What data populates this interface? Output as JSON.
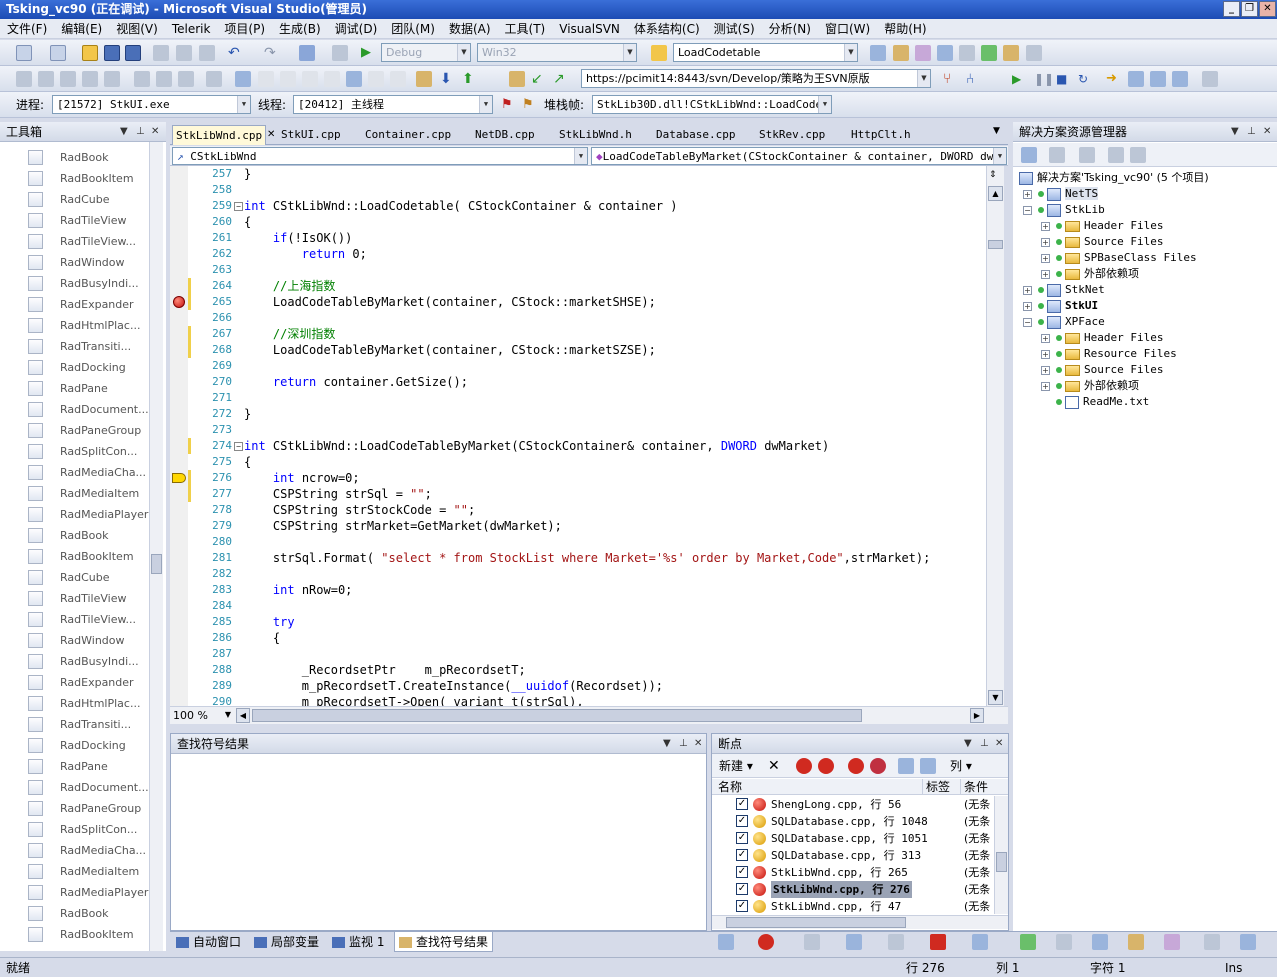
{
  "window": {
    "title": "Tsking_vc90 (正在调试) - Microsoft Visual Studio(管理员)",
    "controls": [
      "_",
      "❐",
      "✕"
    ]
  },
  "menu": [
    "文件(F)",
    "编辑(E)",
    "视图(V)",
    "Telerik",
    "项目(P)",
    "生成(B)",
    "调试(D)",
    "团队(M)",
    "数据(A)",
    "工具(T)",
    "VisualSVN",
    "体系结构(C)",
    "测试(S)",
    "分析(N)",
    "窗口(W)",
    "帮助(H)"
  ],
  "toolbar1": {
    "config": "Debug",
    "platform": "Win32",
    "find": "LoadCodetable"
  },
  "toolbar2": {
    "svn_url": "https://pcimit14:8443/svn/Develop/策略为王SVN原版"
  },
  "toolbar3": {
    "process_label": "进程:",
    "process": "[21572] StkUI.exe",
    "thread_label": "线程:",
    "thread": "[20412] 主线程",
    "stack_label": "堆栈帧:",
    "stack": "StkLib30D.dll!CStkLibWnd::LoadCodeTab"
  },
  "toolbox": {
    "title": "工具箱",
    "items": [
      "RadBook",
      "RadBookItem",
      "RadCube",
      "RadTileView",
      "RadTileView...",
      "RadWindow",
      "RadBusyIndi...",
      "RadExpander",
      "RadHtmlPlac...",
      "RadTransiti...",
      "RadDocking",
      "RadPane",
      "RadDocument...",
      "RadPaneGroup",
      "RadSplitCon...",
      "RadMediaCha...",
      "RadMediaItem",
      "RadMediaPlayer",
      "RadBook",
      "RadBookItem",
      "RadCube",
      "RadTileView",
      "RadTileView...",
      "RadWindow",
      "RadBusyIndi...",
      "RadExpander",
      "RadHtmlPlac...",
      "RadTransiti...",
      "RadDocking",
      "RadPane",
      "RadDocument...",
      "RadPaneGroup",
      "RadSplitCon...",
      "RadMediaCha...",
      "RadMediaItem",
      "RadMediaPlayer",
      "RadBook",
      "RadBookItem"
    ]
  },
  "tabs": [
    "StkLibWnd.cpp",
    "StkUI.cpp",
    "Container.cpp",
    "NetDB.cpp",
    "StkLibWnd.h",
    "Database.cpp",
    "StkRev.cpp",
    "HttpClt.h"
  ],
  "editor": {
    "class_combo": "CStkLibWnd",
    "method_combo": "LoadCodeTableByMarket(CStockContainer & container, DWORD dwMarke",
    "zoom": "100 %"
  },
  "code": [
    {
      "n": "257",
      "t": "}",
      "k": "p"
    },
    {
      "n": "258",
      "t": "",
      "k": "p"
    },
    {
      "n": "259",
      "t": "int CStkLibWnd::LoadCodetable( CStockContainer & container )",
      "k": "fn"
    },
    {
      "n": "260",
      "t": "{",
      "k": "p"
    },
    {
      "n": "261",
      "t": "    if(!IsOK())",
      "k": "if"
    },
    {
      "n": "262",
      "t": "        return 0;",
      "k": "ret"
    },
    {
      "n": "263",
      "t": "",
      "k": "p"
    },
    {
      "n": "264",
      "t": "    //上海指数",
      "k": "cm"
    },
    {
      "n": "265",
      "t": "    LoadCodeTableByMarket(container, CStock::marketSHSE);",
      "k": "p"
    },
    {
      "n": "266",
      "t": "",
      "k": "p"
    },
    {
      "n": "267",
      "t": "    //深圳指数",
      "k": "cm"
    },
    {
      "n": "268",
      "t": "    LoadCodeTableByMarket(container, CStock::marketSZSE);",
      "k": "p"
    },
    {
      "n": "269",
      "t": "",
      "k": "p"
    },
    {
      "n": "270",
      "t": "    return container.GetSize();",
      "k": "ret"
    },
    {
      "n": "271",
      "t": "",
      "k": "p"
    },
    {
      "n": "272",
      "t": "}",
      "k": "p"
    },
    {
      "n": "273",
      "t": "",
      "k": "p"
    },
    {
      "n": "274",
      "t": "int CStkLibWnd::LoadCodeTableByMarket(CStockContainer& container, DWORD dwMarket)",
      "k": "fn"
    },
    {
      "n": "275",
      "t": "{",
      "k": "p"
    },
    {
      "n": "276",
      "t": "    int ncrow=0;",
      "k": "int"
    },
    {
      "n": "277",
      "t": "    CSPString strSql = \"\";",
      "k": "p"
    },
    {
      "n": "278",
      "t": "    CSPString strStockCode = \"\";",
      "k": "p"
    },
    {
      "n": "279",
      "t": "    CSPString strMarket=GetMarket(dwMarket);",
      "k": "p"
    },
    {
      "n": "280",
      "t": "",
      "k": "p"
    },
    {
      "n": "281",
      "t": "    strSql.Format( \"select * from StockList where Market='%s' order by Market,Code\",strMarket);",
      "k": "p"
    },
    {
      "n": "282",
      "t": "",
      "k": "p"
    },
    {
      "n": "283",
      "t": "    int nRow=0;",
      "k": "int"
    },
    {
      "n": "284",
      "t": "",
      "k": "p"
    },
    {
      "n": "285",
      "t": "    try",
      "k": "try"
    },
    {
      "n": "286",
      "t": "    {",
      "k": "p"
    },
    {
      "n": "287",
      "t": "",
      "k": "p"
    },
    {
      "n": "288",
      "t": "        _RecordsetPtr    m_pRecordsetT;",
      "k": "p"
    },
    {
      "n": "289",
      "t": "        m_pRecordsetT.CreateInstance(__uuidof(Recordset));",
      "k": "p"
    },
    {
      "n": "290",
      "t": "        m_pRecordsetT->Open( variant_t(strSql),",
      "k": "p"
    }
  ],
  "solution": {
    "title": "解决方案资源管理器",
    "root": "解决方案'Tsking_vc90' (5 个项目)",
    "nodes": [
      {
        "label": "NetTS",
        "type": "prj",
        "lvl": 1,
        "exp": "+",
        "bold": false
      },
      {
        "label": "StkLib",
        "type": "prj",
        "lvl": 1,
        "exp": "-",
        "bold": false
      },
      {
        "label": "Header Files",
        "type": "fld",
        "lvl": 2,
        "exp": "+",
        "bold": false
      },
      {
        "label": "Source Files",
        "type": "fld",
        "lvl": 2,
        "exp": "+",
        "bold": false
      },
      {
        "label": "SPBaseClass Files",
        "type": "fld",
        "lvl": 2,
        "exp": "+",
        "bold": false
      },
      {
        "label": "外部依赖项",
        "type": "fld",
        "lvl": 2,
        "exp": "+",
        "bold": false
      },
      {
        "label": "StkNet",
        "type": "prj",
        "lvl": 1,
        "exp": "+",
        "bold": false
      },
      {
        "label": "StkUI",
        "type": "prj",
        "lvl": 1,
        "exp": "+",
        "bold": true
      },
      {
        "label": "XPFace",
        "type": "prj",
        "lvl": 1,
        "exp": "-",
        "bold": false
      },
      {
        "label": "Header Files",
        "type": "fld",
        "lvl": 2,
        "exp": "+",
        "bold": false
      },
      {
        "label": "Resource Files",
        "type": "fld",
        "lvl": 2,
        "exp": "+",
        "bold": false
      },
      {
        "label": "Source Files",
        "type": "fld",
        "lvl": 2,
        "exp": "+",
        "bold": false
      },
      {
        "label": "外部依赖项",
        "type": "fld",
        "lvl": 2,
        "exp": "+",
        "bold": false
      },
      {
        "label": "ReadMe.txt",
        "type": "file",
        "lvl": 2,
        "exp": "",
        "bold": false
      }
    ]
  },
  "find_symbol": {
    "title": "查找符号结果"
  },
  "breakpoints": {
    "title": "断点",
    "new_label": "新建",
    "columns_label": "列",
    "headers": [
      "名称",
      "标签",
      "条件"
    ],
    "rows": [
      {
        "text": "ShengLong.cpp, 行 56",
        "cond": "(无条",
        "warn": false,
        "sel": false
      },
      {
        "text": "SQLDatabase.cpp, 行 1048",
        "cond": "(无条",
        "warn": true,
        "sel": false
      },
      {
        "text": "SQLDatabase.cpp, 行 1051",
        "cond": "(无条",
        "warn": true,
        "sel": false
      },
      {
        "text": "SQLDatabase.cpp, 行 313",
        "cond": "(无条",
        "warn": true,
        "sel": false
      },
      {
        "text": "StkLibWnd.cpp, 行 265",
        "cond": "(无条",
        "warn": false,
        "sel": false
      },
      {
        "text": "StkLibWnd.cpp, 行 276",
        "cond": "(无条",
        "warn": false,
        "sel": true
      },
      {
        "text": "StkLibWnd.cpp, 行 47",
        "cond": "(无条",
        "warn": true,
        "sel": false
      }
    ]
  },
  "bottom_tabs": [
    "自动窗口",
    "局部变量",
    "监视 1",
    "查找符号结果"
  ],
  "status": {
    "ready": "就绪",
    "line": "行 276",
    "col": "列 1",
    "ch": "字符 1",
    "mode": "Ins"
  }
}
